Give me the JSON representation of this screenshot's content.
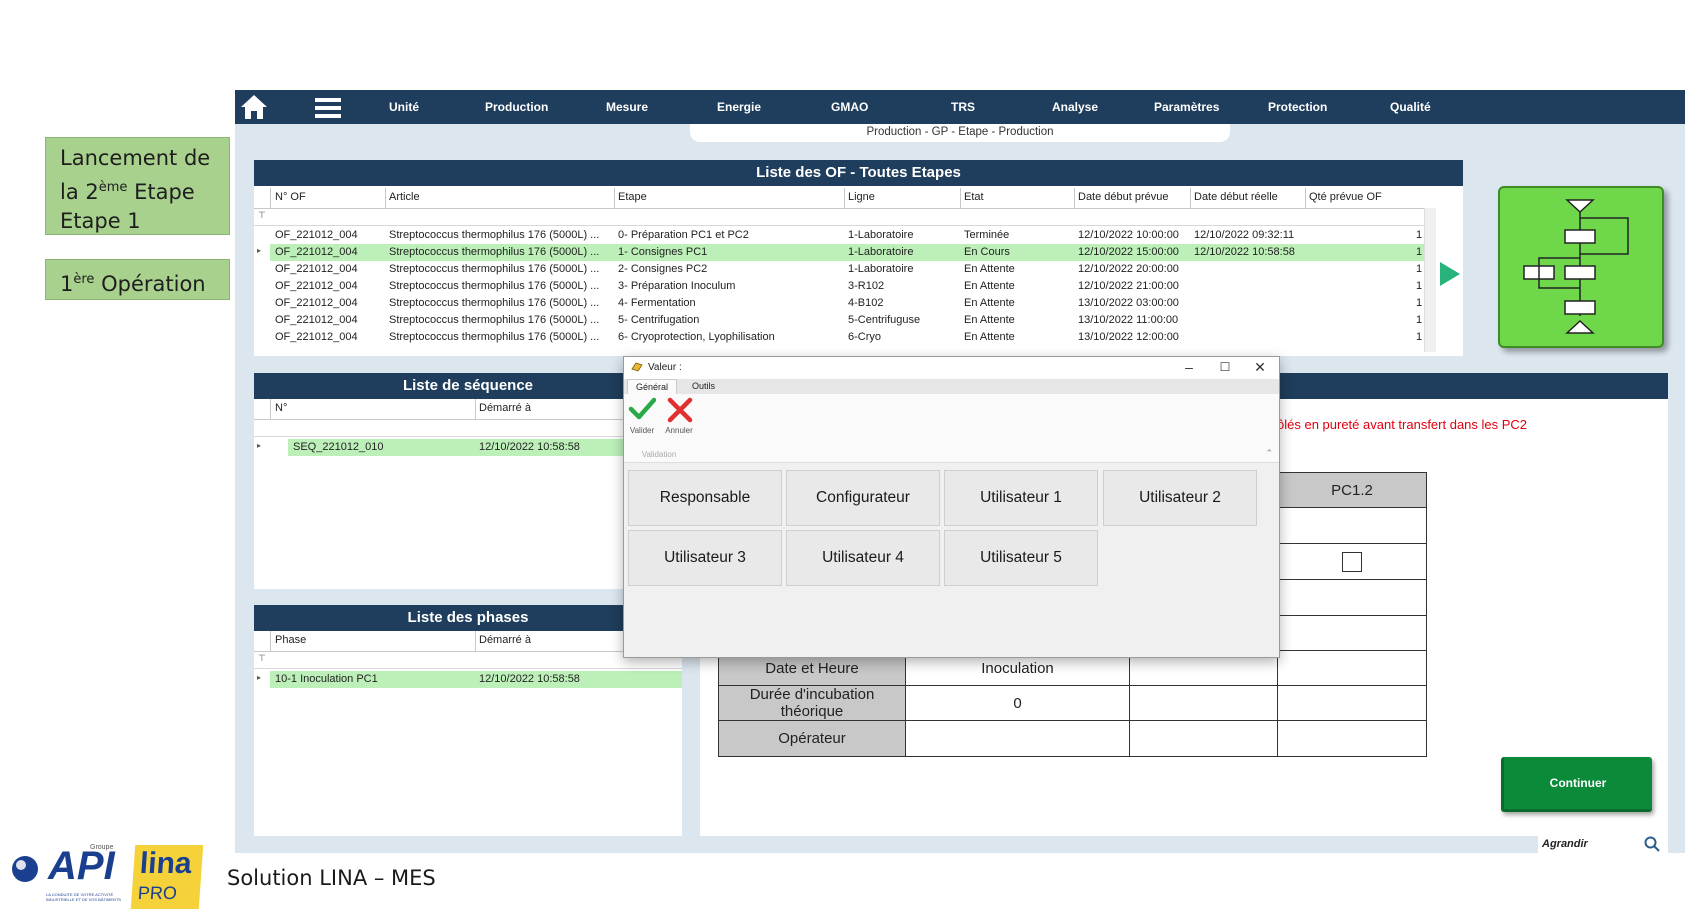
{
  "annotations": {
    "launch_line1": "Lancement de",
    "launch_line2_prefix": "la 2",
    "launch_line2_sup": "ème",
    "launch_line2_suffix": " Etape",
    "launch_line3": "Etape 1",
    "operation_prefix": "1",
    "operation_sup": "ère",
    "operation_suffix": " Opération"
  },
  "navbar": {
    "items": [
      "Unité",
      "Production",
      "Mesure",
      "Energie",
      "GMAO",
      "TRS",
      "Analyse",
      "Paramètres",
      "Protection",
      "Qualité"
    ]
  },
  "breadcrumb": "Production - GP - Etape - Production",
  "of_list": {
    "title": "Liste des OF - Toutes Etapes",
    "columns": [
      "N° OF",
      "Article",
      "Etape",
      "Ligne",
      "Etat",
      "Date début prévue",
      "Date début réelle",
      "Qté prévue OF"
    ],
    "rows": [
      [
        "OF_221012_004",
        "Streptococcus thermophilus 176 (5000L) ...",
        "0- Préparation PC1 et PC2",
        "1-Laboratoire",
        "Terminée",
        "12/10/2022 10:00:00",
        "12/10/2022 09:32:11",
        "1"
      ],
      [
        "OF_221012_004",
        "Streptococcus thermophilus 176 (5000L) ...",
        "1- Consignes PC1",
        "1-Laboratoire",
        "En Cours",
        "12/10/2022 15:00:00",
        "12/10/2022 10:58:58",
        "1"
      ],
      [
        "OF_221012_004",
        "Streptococcus thermophilus 176 (5000L) ...",
        "2- Consignes PC2",
        "1-Laboratoire",
        "En Attente",
        "12/10/2022 20:00:00",
        "",
        "1"
      ],
      [
        "OF_221012_004",
        "Streptococcus thermophilus 176 (5000L) ...",
        "3- Préparation Inoculum",
        "3-R102",
        "En Attente",
        "12/10/2022 21:00:00",
        "",
        "1"
      ],
      [
        "OF_221012_004",
        "Streptococcus thermophilus 176 (5000L) ...",
        "4- Fermentation",
        "4-B102",
        "En Attente",
        "13/10/2022 03:00:00",
        "",
        "1"
      ],
      [
        "OF_221012_004",
        "Streptococcus thermophilus 176 (5000L) ...",
        "5- Centrifugation",
        "5-Centrifuguse",
        "En Attente",
        "13/10/2022 11:00:00",
        "",
        "1"
      ],
      [
        "OF_221012_004",
        "Streptococcus thermophilus 176 (5000L) ...",
        "6- Cryoprotection, Lyophilisation",
        "6-Cryo",
        "En Attente",
        "13/10/2022 12:00:00",
        "",
        "1"
      ]
    ]
  },
  "sequence_list": {
    "title": "Liste de séquence",
    "columns": [
      "N°",
      "Démarré à"
    ],
    "rows": [
      [
        "SEQ_221012_010",
        "12/10/2022 10:58:58"
      ]
    ]
  },
  "phase_list": {
    "title": "Liste des phases",
    "columns": [
      "Phase",
      "Démarré à"
    ],
    "rows": [
      [
        "10-1 Inoculation PC1",
        "12/10/2022 10:58:58"
      ]
    ]
  },
  "instruction": "ôlés en pureté avant transfert dans les PC2",
  "check_table": {
    "header_right": "PC1.2",
    "row_date_label": "Date et Heure",
    "row_date_value": "Inoculation",
    "row_duration_label": "Durée d'incubation théorique",
    "row_duration_value": "0",
    "row_operator_label": "Opérateur"
  },
  "continue_label": "Continuer",
  "agrandir_label": "Agrandir",
  "dialog": {
    "title": "Valeur :",
    "tabs": [
      "Général",
      "Outils"
    ],
    "validate_label": "Valider",
    "cancel_label": "Annuler",
    "group_label": "Validation",
    "users": [
      "Responsable",
      "Configurateur",
      "Utilisateur 1",
      "Utilisateur 2",
      "Utilisateur 3",
      "Utilisateur 4",
      "Utilisateur 5"
    ]
  },
  "footer": {
    "solution_text": "Solution LINA – MES",
    "api_logo_text": "API",
    "api_group_text": "Groupe",
    "api_tagline": "LA CONDUITE DE VOTRE ACTIVITÉ INDUSTRIELLE ET DE VOS BÂTIMENTS",
    "lina_logo_text": "lina",
    "lina_pro_text": "PRO"
  },
  "colors": {
    "nav_bg": "#1f3d5c",
    "selection_green": "#bdf0b9",
    "workflow_green": "#6fd84a",
    "continue_green": "#0b8a3a",
    "alert_red": "#e0000f"
  }
}
